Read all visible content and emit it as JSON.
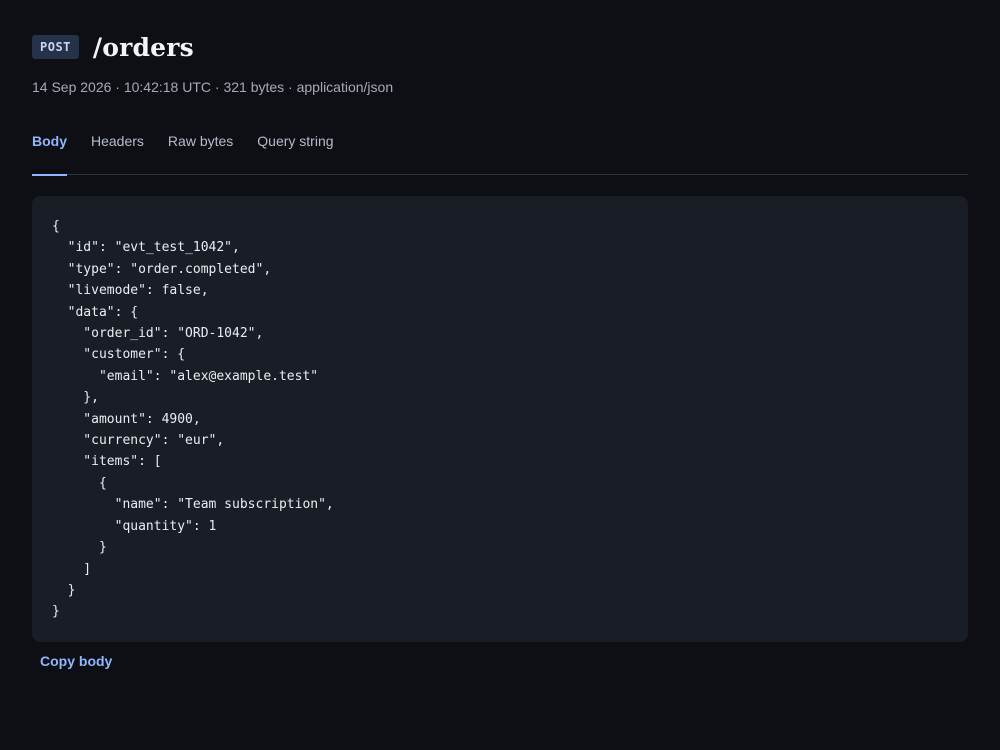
{
  "request": {
    "method": "POST",
    "path": "/orders",
    "meta": "14 Sep 2026 · 10:42:18 UTC · 321 bytes · application/json"
  },
  "tabs": [
    {
      "label": "Body",
      "active": true
    },
    {
      "label": "Headers",
      "active": false
    },
    {
      "label": "Raw bytes",
      "active": false
    },
    {
      "label": "Query string",
      "active": false
    }
  ],
  "body": {
    "code": "{\n  \"id\": \"evt_test_1042\",\n  \"type\": \"order.completed\",\n  \"livemode\": false,\n  \"data\": {\n    \"order_id\": \"ORD-1042\",\n    \"customer\": {\n      \"email\": \"alex@example.test\"\n    },\n    \"amount\": 4900,\n    \"currency\": \"eur\",\n    \"items\": [\n      {\n        \"name\": \"Team subscription\",\n        \"quantity\": 1\n      }\n    ]\n  }\n}"
  },
  "actions": {
    "copy_label": "Copy body"
  },
  "colors": {
    "background": "#0d0f14",
    "panel": "#181d26",
    "accent": "#8fb6ff",
    "badge": "#26324a"
  }
}
